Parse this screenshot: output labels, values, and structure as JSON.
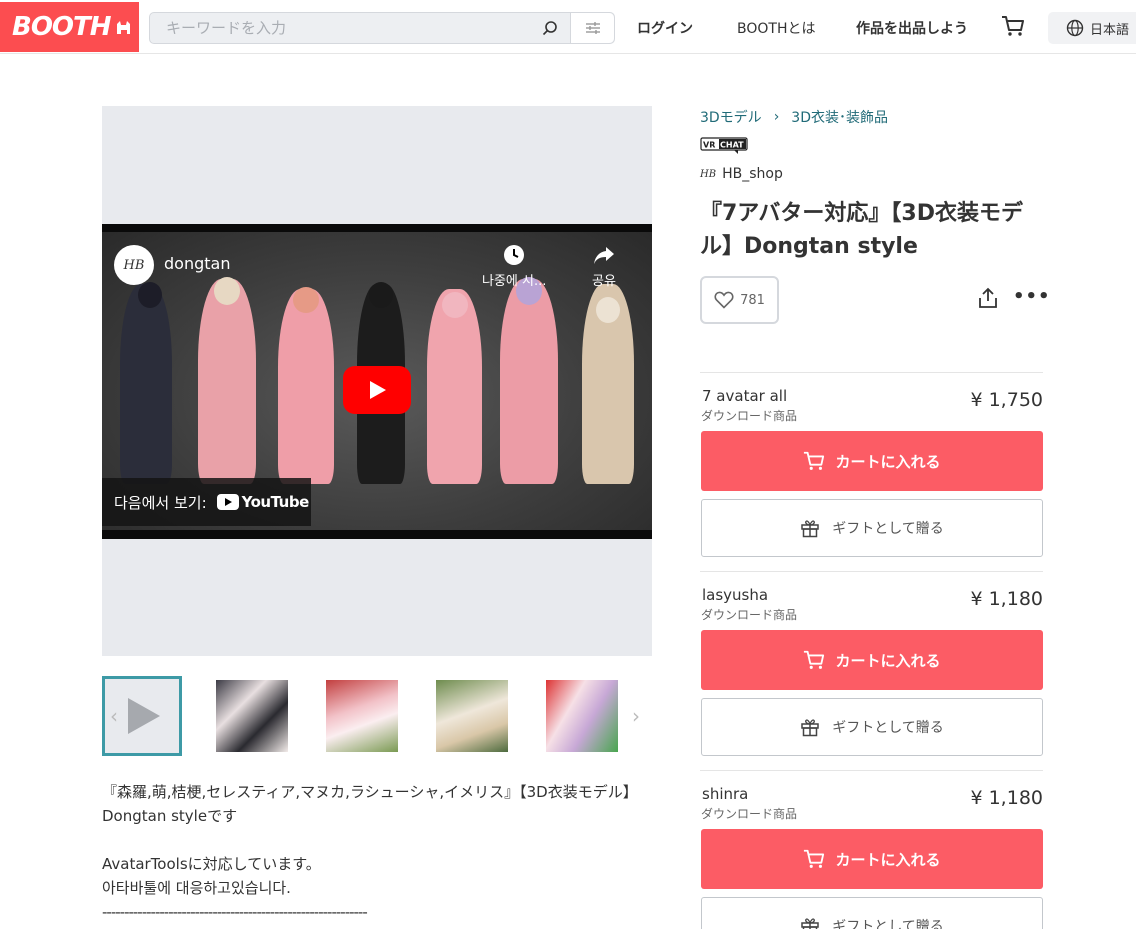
{
  "header": {
    "logo": "BOOTH",
    "search_placeholder": "キーワードを入力",
    "nav": [
      "ログイン",
      "BOOTHとは",
      "作品を出品しよう"
    ],
    "language": "日本語"
  },
  "video": {
    "channel_avatar": "HB",
    "channel_name": "dongtan",
    "watch_later": "나중에 시...",
    "share": "공유",
    "watch_on": "다음에서 보기:",
    "youtube_logo": "YouTube"
  },
  "product": {
    "breadcrumb": [
      "3Dモデル",
      "3D衣装･装飾品"
    ],
    "badge": "VRCHAT",
    "shop_logo": "HB",
    "shop_name": "HB_shop",
    "title": "『7アバター対応』【3D衣装モデル】Dongtan style",
    "likes": "781"
  },
  "variations": [
    {
      "name": "7 avatar all",
      "type": "ダウンロード商品",
      "price": "¥ 1,750",
      "cart_label": "カートに入れる",
      "gift_label": "ギフトとして贈る"
    },
    {
      "name": "lasyusha",
      "type": "ダウンロード商品",
      "price": "¥ 1,180",
      "cart_label": "カートに入れる",
      "gift_label": "ギフトとして贈る"
    },
    {
      "name": "shinra",
      "type": "ダウンロード商品",
      "price": "¥ 1,180",
      "cart_label": "カートに入れる",
      "gift_label": "ギフトとして贈る"
    }
  ],
  "description": {
    "line1": "『森羅,萌,桔梗,セレスティア,マヌカ,ラシューシャ,イメリス』【3D衣装モデル】Dongtan styleです",
    "line2": "AvatarToolsに対応しています。",
    "line3": "아타바툴에 대응하고있습니다.",
    "line4": "------------------------------------------------------------"
  },
  "colors": {
    "brand": "#fc4d50",
    "cart": "#fc5c65",
    "link": "#216b78",
    "thumb_active": "#3d9aa6"
  }
}
